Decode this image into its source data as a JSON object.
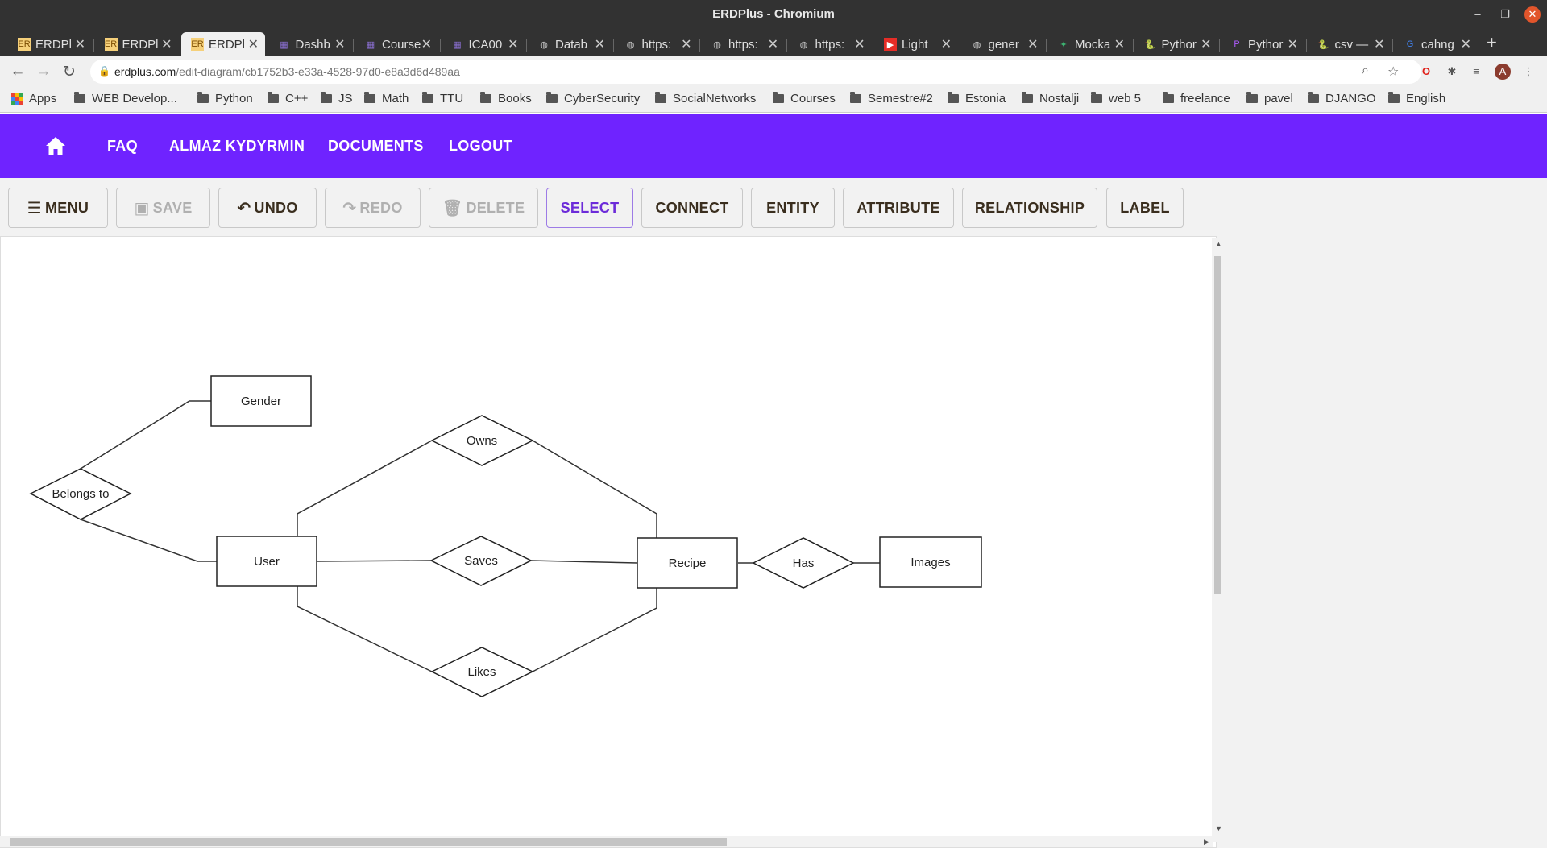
{
  "window": {
    "title": "ERDPlus - Chromium"
  },
  "tabs": [
    {
      "label": "ERDPl",
      "icon": "erdplus-icon"
    },
    {
      "label": "ERDPl",
      "icon": "erdplus-icon"
    },
    {
      "label": "ERDPl",
      "icon": "erdplus-icon",
      "active": true
    },
    {
      "label": "Dashb",
      "icon": "course-icon"
    },
    {
      "label": "Course",
      "icon": "course-icon"
    },
    {
      "label": "ICA00",
      "icon": "course-icon"
    },
    {
      "label": "Datab",
      "icon": "globe-icon"
    },
    {
      "label": "https:",
      "icon": "globe-icon"
    },
    {
      "label": "https:",
      "icon": "globe-icon"
    },
    {
      "label": "https:",
      "icon": "globe-icon"
    },
    {
      "label": "Light",
      "icon": "youtube-icon"
    },
    {
      "label": "gener",
      "icon": "globe-icon"
    },
    {
      "label": "Mocka",
      "icon": "mockaroo-icon"
    },
    {
      "label": "Pythor",
      "icon": "python-icon"
    },
    {
      "label": "Pythor",
      "icon": "pycharm-icon"
    },
    {
      "label": "csv —",
      "icon": "python-icon"
    },
    {
      "label": "cahng",
      "icon": "google-icon"
    }
  ],
  "address": {
    "domain": "erdplus.com",
    "path": "/edit-diagram/cb1752b3-e33a-4528-97d0-e8a3d6d489aa"
  },
  "profile_initial": "A",
  "bookmarks": [
    "Apps",
    "WEB Develop...",
    "Python",
    "C++",
    "JS",
    "Math",
    "TTU",
    "Books",
    "CyberSecurity",
    "SocialNetworks",
    "Courses",
    "Semestre#2",
    "Estonia",
    "Nostalji",
    "web 5",
    "freelance",
    "pavel",
    "DJANGO",
    "English"
  ],
  "appnav": {
    "faq": "FAQ",
    "user": "ALMAZ KYDYRMIN",
    "documents": "DOCUMENTS",
    "logout": "LOGOUT"
  },
  "diagram_toolbar": {
    "menu": "MENU",
    "save": "SAVE",
    "undo": "UNDO",
    "redo": "REDO",
    "delete": "DELETE",
    "select": "SELECT",
    "connect": "CONNECT",
    "entity": "ENTITY",
    "attribute": "ATTRIBUTE",
    "relationship": "RELATIONSHIP",
    "label": "LABEL"
  },
  "diagram": {
    "entities": [
      "Gender",
      "User",
      "Recipe",
      "Images"
    ],
    "relationships": [
      "Belongs to",
      "Owns",
      "Saves",
      "Likes",
      "Has"
    ]
  },
  "colors": {
    "brand": "#6f23ff",
    "select_accent": "#6c2bd9"
  }
}
